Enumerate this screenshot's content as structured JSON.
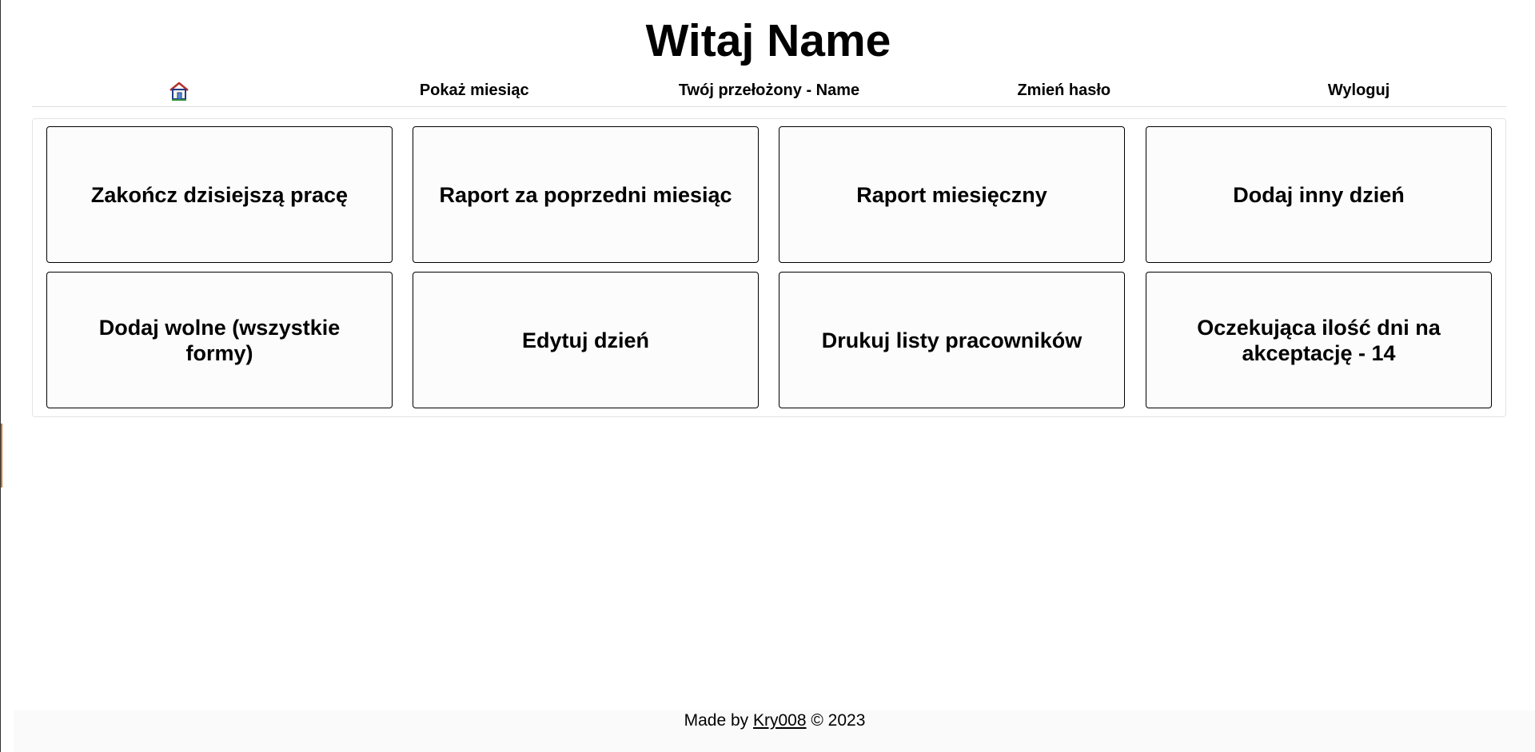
{
  "header": {
    "title": "Witaj Name"
  },
  "nav": {
    "home_icon": "home-icon",
    "items": [
      {
        "label": "Pokaż miesiąc"
      },
      {
        "label": "Twój przełożony - Name"
      },
      {
        "label": "Zmień hasło"
      },
      {
        "label": "Wyloguj"
      }
    ]
  },
  "tiles": [
    {
      "label": "Zakończ dzisiejszą pracę"
    },
    {
      "label": "Raport za poprzedni miesiąc"
    },
    {
      "label": "Raport miesięczny"
    },
    {
      "label": "Dodaj inny dzień"
    },
    {
      "label": "Dodaj wolne (wszystkie formy)"
    },
    {
      "label": "Edytuj dzień"
    },
    {
      "label": "Drukuj listy pracowników"
    },
    {
      "label": "Oczekująca ilość dni na akceptację - 14"
    }
  ],
  "footer": {
    "prefix": "Made by",
    "author_link": "Kry008",
    "suffix": "© 2023"
  }
}
